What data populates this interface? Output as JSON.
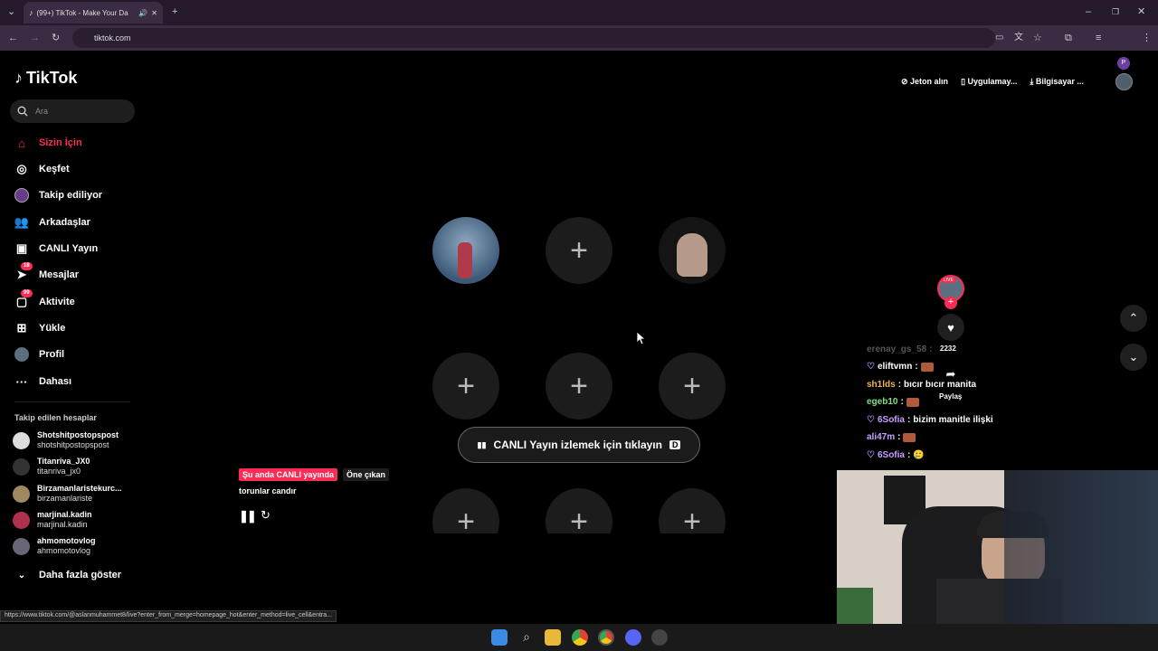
{
  "browser": {
    "tab_title": "(99+) TikTok - Make Your Da",
    "url": "tiktok.com",
    "status_url": "https://www.tiktok.com/@aslanmuhammet8/live?enter_from_merge=homepage_hot&enter_method=live_cell&entra..."
  },
  "brand": "TikTok",
  "search": {
    "placeholder": "Ara"
  },
  "nav": [
    {
      "label": "Sizin İçin",
      "icon": "home-icon",
      "active": true
    },
    {
      "label": "Keşfet",
      "icon": "compass-icon"
    },
    {
      "label": "Takip ediliyor",
      "icon": "following-avatar"
    },
    {
      "label": "Arkadaşlar",
      "icon": "friends-icon"
    },
    {
      "label": "CANLI Yayın",
      "icon": "live-icon"
    },
    {
      "label": "Mesajlar",
      "icon": "message-icon",
      "badge": "18"
    },
    {
      "label": "Aktivite",
      "icon": "activity-icon",
      "badge": "99"
    },
    {
      "label": "Yükle",
      "icon": "upload-icon"
    },
    {
      "label": "Profil",
      "icon": "profile-avatar"
    },
    {
      "label": "Dahası",
      "icon": "more-icon"
    }
  ],
  "following": {
    "heading": "Takip edilen hesaplar",
    "accounts": [
      {
        "name": "Shotshitpostopspost",
        "handle": "shotshitpostopspost"
      },
      {
        "name": "Titanriva_JX0",
        "handle": "titanriva_jx0"
      },
      {
        "name": "Birzamanlaristekurc...",
        "handle": "birzamanlariste"
      },
      {
        "name": "marjinal.kadin",
        "handle": "marjinal.kadin"
      },
      {
        "name": "ahmomotovlog",
        "handle": "ahmomotovlog"
      }
    ],
    "show_more": "Daha fazla göster"
  },
  "header": {
    "coins": "Jeton alın",
    "app": "Uygulamay...",
    "desktop": "Bilgisayar ..."
  },
  "live": {
    "cta": "CANLI Yayın izlemek için tıklayın",
    "cta_key": "D",
    "tag_live": "Şu anda CANLI yayında",
    "tag_featured": "Öne çıkan",
    "caption": "torunlar candır"
  },
  "side_actions": {
    "like_count": "2232",
    "share_label": "Paylaş",
    "live_badge": "LIVE"
  },
  "chat": [
    {
      "user": "erenay_gs_58",
      "msg": "",
      "faded": true
    },
    {
      "user": "eliftvmn",
      "msg": "",
      "gift": true
    },
    {
      "user": "sh1lds",
      "msg": "bıcır bıcır manita"
    },
    {
      "user": "egeb10",
      "msg": "",
      "gift": true
    },
    {
      "user": "6Sofia",
      "msg": "bizim manitle ilişki"
    },
    {
      "user": "ali47m",
      "msg": "",
      "gift": true
    },
    {
      "user": "6Sofia",
      "msg": "",
      "emoji": "🥲"
    }
  ],
  "colors": {
    "brand": "#fe2c55",
    "bg": "#000000",
    "chrome": "#3a2c42"
  }
}
